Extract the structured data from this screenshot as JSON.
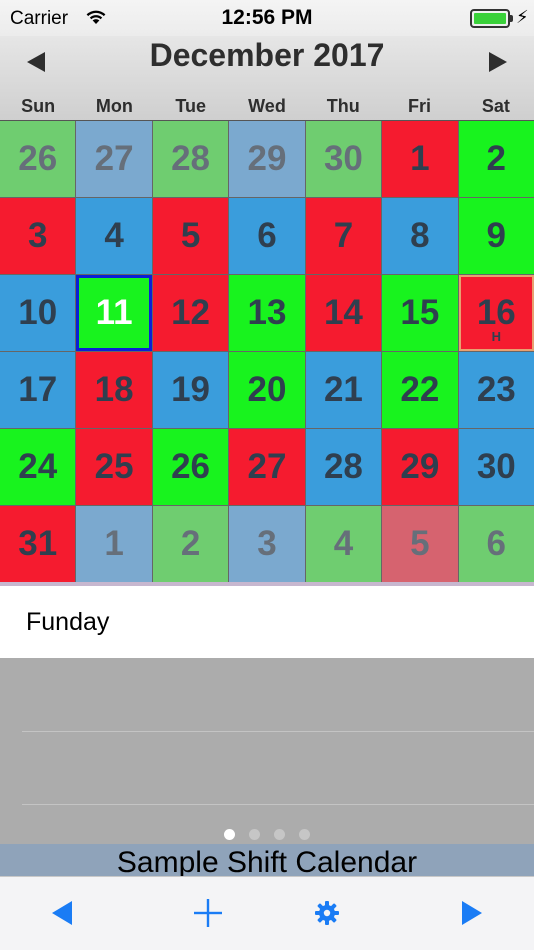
{
  "status_bar": {
    "carrier": "Carrier",
    "time": "12:56 PM"
  },
  "header": {
    "month_title": "December 2017",
    "prev_icon": "left-arrow-icon",
    "next_icon": "right-arrow-icon"
  },
  "weekdays": [
    "Sun",
    "Mon",
    "Tue",
    "Wed",
    "Thu",
    "Fri",
    "Sat"
  ],
  "colors": {
    "red_shift": "#f51b2f",
    "blue_shift": "#3a9ddc",
    "green_shift": "#18f31e",
    "selection": "#0a1fd6",
    "toolbar_accent": "#1a7cf5"
  },
  "calendar": {
    "days": [
      {
        "d": "26",
        "c": "green",
        "out": true
      },
      {
        "d": "27",
        "c": "blue",
        "out": true
      },
      {
        "d": "28",
        "c": "green",
        "out": true
      },
      {
        "d": "29",
        "c": "blue",
        "out": true
      },
      {
        "d": "30",
        "c": "green",
        "out": true
      },
      {
        "d": "1",
        "c": "red"
      },
      {
        "d": "2",
        "c": "green"
      },
      {
        "d": "3",
        "c": "red"
      },
      {
        "d": "4",
        "c": "blue"
      },
      {
        "d": "5",
        "c": "red"
      },
      {
        "d": "6",
        "c": "blue"
      },
      {
        "d": "7",
        "c": "red"
      },
      {
        "d": "8",
        "c": "blue"
      },
      {
        "d": "9",
        "c": "green"
      },
      {
        "d": "10",
        "c": "blue"
      },
      {
        "d": "11",
        "c": "green",
        "selected": true
      },
      {
        "d": "12",
        "c": "red"
      },
      {
        "d": "13",
        "c": "green"
      },
      {
        "d": "14",
        "c": "red"
      },
      {
        "d": "15",
        "c": "green"
      },
      {
        "d": "16",
        "c": "red",
        "today": true,
        "marker": "H"
      },
      {
        "d": "17",
        "c": "blue"
      },
      {
        "d": "18",
        "c": "red"
      },
      {
        "d": "19",
        "c": "blue"
      },
      {
        "d": "20",
        "c": "green"
      },
      {
        "d": "21",
        "c": "blue"
      },
      {
        "d": "22",
        "c": "green"
      },
      {
        "d": "23",
        "c": "blue"
      },
      {
        "d": "24",
        "c": "green"
      },
      {
        "d": "25",
        "c": "red"
      },
      {
        "d": "26",
        "c": "green"
      },
      {
        "d": "27",
        "c": "red"
      },
      {
        "d": "28",
        "c": "blue"
      },
      {
        "d": "29",
        "c": "red"
      },
      {
        "d": "30",
        "c": "blue"
      },
      {
        "d": "31",
        "c": "red"
      },
      {
        "d": "1",
        "c": "blue",
        "out": true
      },
      {
        "d": "2",
        "c": "green",
        "out": true
      },
      {
        "d": "3",
        "c": "blue",
        "out": true
      },
      {
        "d": "4",
        "c": "green",
        "out": true
      },
      {
        "d": "5",
        "c": "red",
        "out": true
      },
      {
        "d": "6",
        "c": "green",
        "out": true
      }
    ]
  },
  "event": {
    "label": "Funday"
  },
  "pager": {
    "pages": 4,
    "current": 0
  },
  "footer": {
    "title": "Sample Shift Calendar"
  },
  "toolbar": {
    "items": [
      {
        "name": "previous-button",
        "icon": "left-triangle-icon"
      },
      {
        "name": "add-button",
        "icon": "plus-icon"
      },
      {
        "name": "settings-button",
        "icon": "gear-icon"
      },
      {
        "name": "next-button",
        "icon": "right-triangle-icon"
      }
    ]
  }
}
